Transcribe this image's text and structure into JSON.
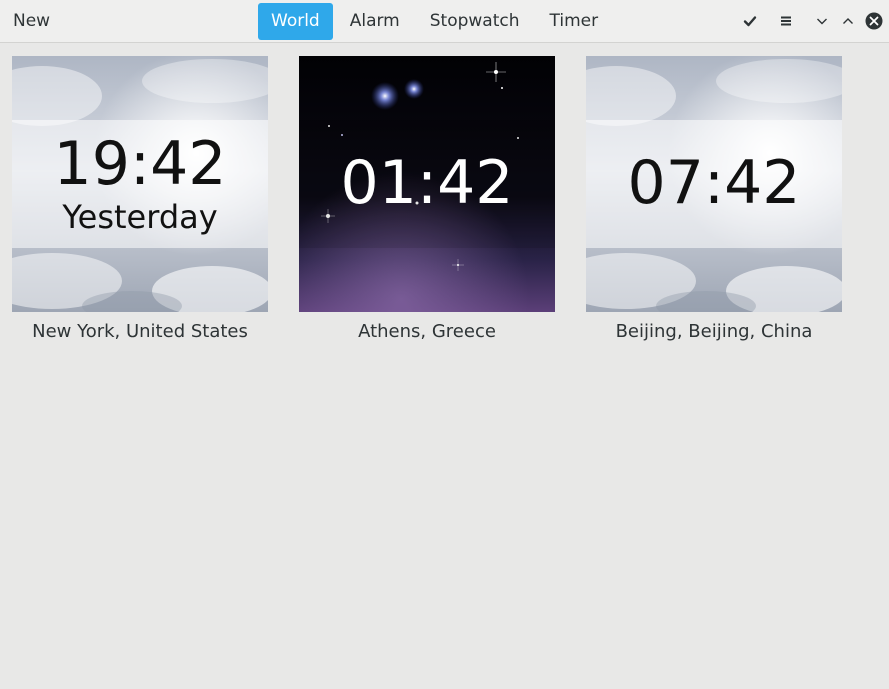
{
  "header": {
    "new_label": "New",
    "tabs": [
      {
        "label": "World",
        "active": true
      },
      {
        "label": "Alarm",
        "active": false
      },
      {
        "label": "Stopwatch",
        "active": false
      },
      {
        "label": "Timer",
        "active": false
      }
    ],
    "controls": [
      "selection-check-icon",
      "menu-icon",
      "minimize-chevron-icon",
      "maximize-chevron-icon",
      "close-icon"
    ]
  },
  "clocks": [
    {
      "time": "19:42",
      "day": "Yesterday",
      "location": "New York, United States",
      "theme": "day"
    },
    {
      "time": "01:42",
      "day": "",
      "location": "Athens, Greece",
      "theme": "night"
    },
    {
      "time": "07:42",
      "day": "",
      "location": "Beijing, Beijing, China",
      "theme": "day"
    }
  ],
  "colors": {
    "accent": "#2fa8ea",
    "text": "#2e3436",
    "background": "#e8e8e7"
  }
}
